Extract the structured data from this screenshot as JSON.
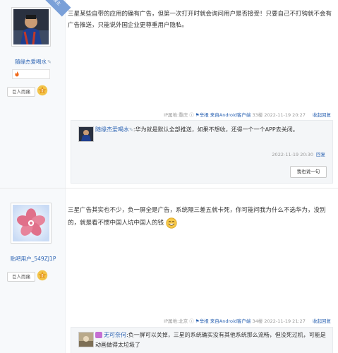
{
  "post1": {
    "ribbon": "楼主",
    "username": "随缘杰爱喝水",
    "badge_icon": "fire-icon",
    "level_label": "巨人而痛",
    "content": "三星某些自带的应用的确有广告，但第一次打开时就会询问用户是否接受！只要自己不打钩就不会有广告推送，只能说外国企业更尊重用户隐私。",
    "meta": {
      "ip": "IP属地:重庆",
      "report": "举报",
      "client": "来自Android客户端",
      "floor": "33楼",
      "time": "2022-11-19 20:27",
      "collapse": "收起回复"
    },
    "reply": {
      "name": "随缘杰爱喝水",
      "text": ":华为就是默认全部推送，如果不想收，还得一个一个APP去关闭。",
      "time": "2022-11-19 20:30",
      "reply_link": "回复"
    },
    "say_button": "我也说一句"
  },
  "post2": {
    "username": "贴吧用户_549ZJ1P",
    "level_label": "巨人而痛",
    "content_a": "三星广告其实也不少，负一屏全是广告，系统隔三差五就卡死，你可能问我为什么不选华为，没别的，就是看不惯中国人坑中国人的钱",
    "meta": {
      "ip": "IP属地:北京",
      "report": "举报",
      "client": "来自Android客户端",
      "floor": "34楼",
      "time": "2022-11-19 21:27",
      "collapse": "收起回复"
    },
    "reply": {
      "name": "无可奈何",
      "text": ":负一屏可以关掉，三星的系统确实没有其他系统那么流畅，但没死过机，可能是动画做得太垃圾了"
    }
  }
}
